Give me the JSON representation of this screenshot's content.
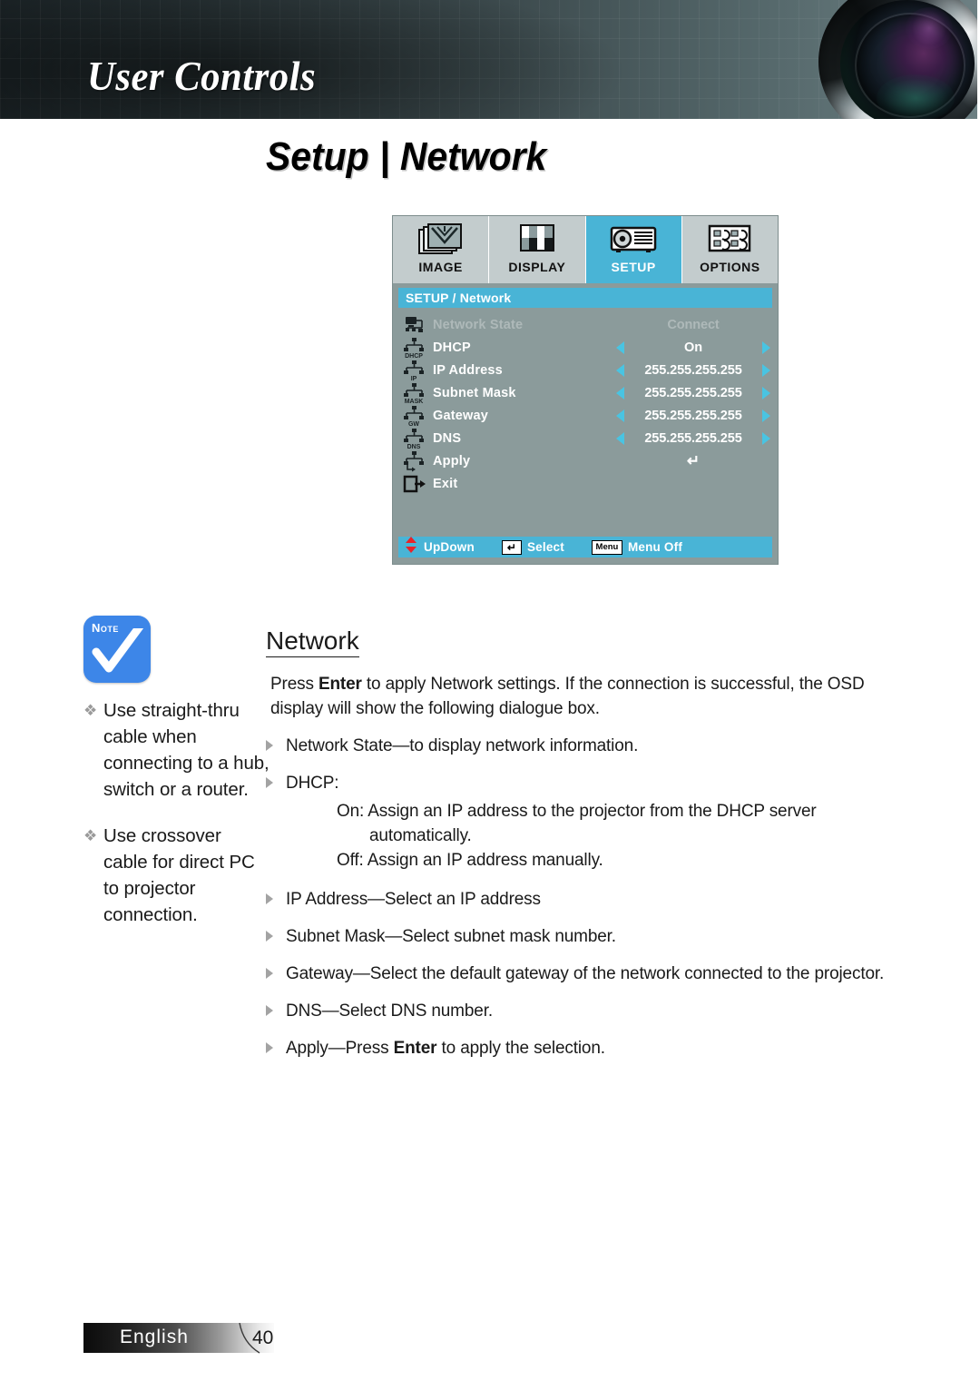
{
  "header": {
    "section_title": "User Controls"
  },
  "page": {
    "title": "Setup | Network"
  },
  "osd": {
    "tabs": [
      {
        "label": "IMAGE",
        "icon": "image-icon",
        "active": false
      },
      {
        "label": "DISPLAY",
        "icon": "display-icon",
        "active": false
      },
      {
        "label": "SETUP",
        "icon": "projector-icon",
        "active": true
      },
      {
        "label": "OPTIONS",
        "icon": "options-icon",
        "active": false
      }
    ],
    "title_bar": "SETUP / Network",
    "rows": [
      {
        "label": "Network State",
        "value": "Connect",
        "icon": "network-state-icon",
        "icon_label": "",
        "arrows": false,
        "disabled": true
      },
      {
        "label": "DHCP",
        "value": "On",
        "icon": "network-tree-icon",
        "icon_label": "DHCP",
        "arrows": true,
        "disabled": false
      },
      {
        "label": "IP Address",
        "value": "255.255.255.255",
        "icon": "network-tree-icon",
        "icon_label": "IP",
        "arrows": true,
        "disabled": false
      },
      {
        "label": "Subnet Mask",
        "value": "255.255.255.255",
        "icon": "network-tree-icon",
        "icon_label": "MASK",
        "arrows": true,
        "disabled": false
      },
      {
        "label": "Gateway",
        "value": "255.255.255.255",
        "icon": "network-tree-icon",
        "icon_label": "GW",
        "arrows": true,
        "disabled": false
      },
      {
        "label": "DNS",
        "value": "255.255.255.255",
        "icon": "network-tree-icon",
        "icon_label": "DNS",
        "arrows": true,
        "disabled": false
      },
      {
        "label": "Apply",
        "value": "↵",
        "icon": "network-apply-icon",
        "icon_label": "",
        "arrows": false,
        "disabled": false
      },
      {
        "label": "Exit",
        "value": "",
        "icon": "exit-icon",
        "icon_label": "",
        "arrows": false,
        "disabled": false
      }
    ],
    "footer": [
      {
        "key_icon": "up-down-arrows-icon",
        "key_text": "",
        "label": "UpDown"
      },
      {
        "key_icon": "enter-key-icon",
        "key_text": "↵",
        "label": "Select"
      },
      {
        "key_icon": "menu-key-icon",
        "key_text": "Menu",
        "label": "Menu Off"
      }
    ],
    "colors": {
      "accent": "#49b4d6",
      "arrow": "#49c4e2",
      "body_bg": "#8b9b9b",
      "tab_bg": "#c3cccd"
    }
  },
  "note": {
    "badge_label": "Note",
    "items": [
      "Use straight-thru cable when connecting to a hub, switch or a router.",
      "Use crossover cable for direct PC to projector connection."
    ]
  },
  "content": {
    "heading": "Network",
    "intro": "Press Enter to apply Network settings. If the connection is successful, the OSD display will show the following dialogue box.",
    "intro_bold": "Enter",
    "bullets": [
      {
        "text": "Network State—to display network information.",
        "subs": []
      },
      {
        "text": "DHCP:",
        "subs": [
          "On: Assign an IP address to the projector from the DHCP server",
          "automatically.",
          "Off: Assign an IP address manually."
        ]
      },
      {
        "text": "IP Address—Select an IP address",
        "subs": []
      },
      {
        "text": "Subnet Mask—Select subnet mask number.",
        "subs": []
      },
      {
        "text": "Gateway—Select the default gateway of the network connected to the projector.",
        "subs": []
      },
      {
        "text": "DNS—Select DNS number.",
        "subs": []
      },
      {
        "text": "Apply—Press Enter to apply the selection.",
        "subs": [],
        "bold_word": "Enter"
      }
    ]
  },
  "footer": {
    "language": "English",
    "page_number": "40"
  }
}
